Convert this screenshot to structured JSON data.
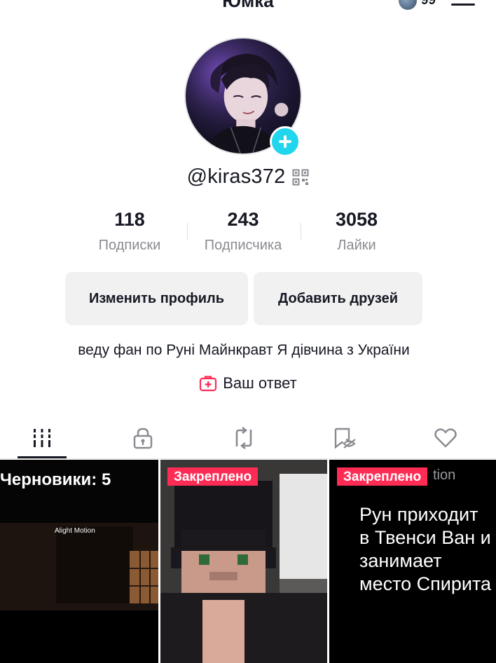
{
  "header": {
    "title": "Юмка",
    "notification_count": "99"
  },
  "profile": {
    "username": "@kiras372",
    "stats": [
      {
        "value": "118",
        "label": "Подписки"
      },
      {
        "value": "243",
        "label": "Подписчика"
      },
      {
        "value": "3058",
        "label": "Лайки"
      }
    ],
    "buttons": {
      "edit_profile": "Изменить профиль",
      "add_friends": "Добавить друзей"
    },
    "bio": "веду фан по Руні Майнкравт Я дівчина з України",
    "answer_label": "Ваш ответ"
  },
  "tabs": [
    {
      "icon": "grid-icon",
      "active": true
    },
    {
      "icon": "lock-icon",
      "active": false
    },
    {
      "icon": "repost-icon",
      "active": false
    },
    {
      "icon": "hidden-bookmark-icon",
      "active": false
    },
    {
      "icon": "heart-icon",
      "active": false
    }
  ],
  "grid": {
    "tile1": {
      "label": "Черновики: 5",
      "watermark": "Alight Motion"
    },
    "tile2": {
      "badge": "Закреплено"
    },
    "tile3": {
      "badge": "Закреплено",
      "watermark_fragment": "tion",
      "text": "Рун приходит в Твенси Ван и занимает место Спирита"
    }
  },
  "colors": {
    "accent_pink": "#fe2c55",
    "badge_cyan": "#20d5ec",
    "button_bg": "#f1f1f2",
    "secondary_text": "#8a8b91"
  }
}
